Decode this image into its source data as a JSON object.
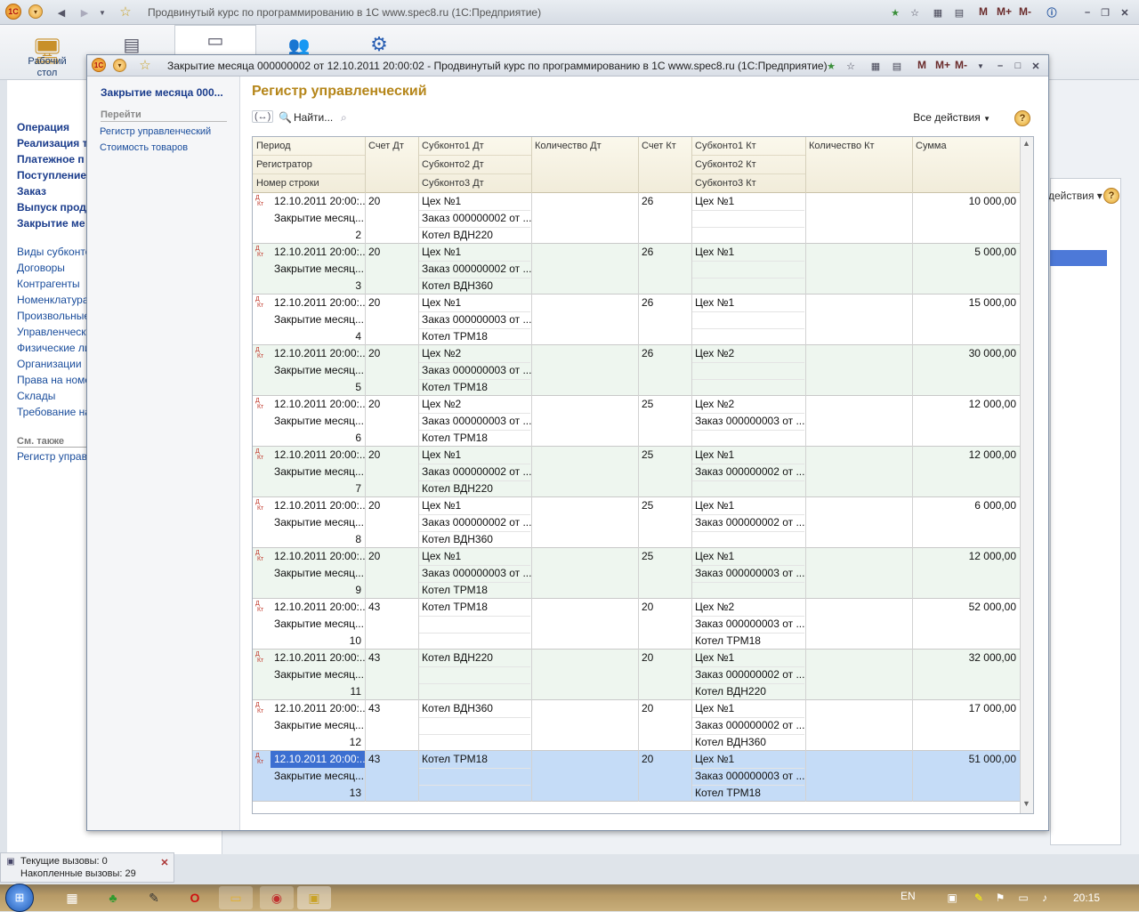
{
  "main_window": {
    "title": "Продвинутый курс по программированию в 1С www.spec8.ru  (1С:Предприятие)",
    "m_buttons": [
      "M",
      "M+",
      "M-"
    ]
  },
  "sections_panel": {
    "desktop_label_line1": "Рабочий",
    "desktop_label_line2": "стол"
  },
  "left_nav": {
    "bold_items": [
      "Операция",
      "Реализация т",
      "Платежное п",
      "Поступление",
      "Заказ",
      "Выпуск прод",
      "Закрытие ме"
    ],
    "items": [
      "Виды субконто",
      "Договоры",
      "Контрагенты",
      "Номенклатура",
      "Произвольные",
      "Управленчески",
      "Физические ли",
      "Организации",
      "Права на номен",
      "Склады",
      "Требование на"
    ],
    "see_also_label": "См. также",
    "see_also_items": [
      "Регистр управл"
    ]
  },
  "background_panel": {
    "actions_label": "действия ▾"
  },
  "dialog": {
    "title": "Закрытие месяца 000000002 от 12.10.2011 20:00:02 - Продвинутый курс по программированию в 1С www.spec8.ru  (1С:Предприятие)",
    "m_buttons": [
      "M",
      "M+",
      "M-"
    ],
    "sidebar": {
      "doc_link": "Закрытие месяца 000...",
      "goto_label": "Перейти",
      "links": [
        "Регистр управленческий",
        "Стоимость товаров"
      ]
    },
    "form_title": "Регистр управленческий",
    "command_bar": {
      "find_label": "Найти...",
      "all_actions_label": "Все действия",
      "help_label": "?"
    },
    "table": {
      "headers": {
        "period": "Период",
        "registrar": "Регистратор",
        "line_no": "Номер строки",
        "acc_dt": "Счет Дт",
        "sub1_dt": "Субконто1 Дт",
        "sub2_dt": "Субконто2 Дт",
        "sub3_dt": "Субконто3 Дт",
        "qty_dt": "Количество Дт",
        "acc_kt": "Счет Кт",
        "sub1_kt": "Субконто1 Кт",
        "sub2_kt": "Субконто2 Кт",
        "sub3_kt": "Субконто3 Кт",
        "qty_kt": "Количество Кт",
        "sum": "Сумма"
      },
      "rows": [
        {
          "period": "12.10.2011 20:00:...",
          "registrar": "Закрытие месяц...",
          "line": "2",
          "acc_dt": "20",
          "sub1_dt": "Цех №1",
          "sub2_dt": "Заказ 000000002 от ...",
          "sub3_dt": "Котел ВДН220",
          "acc_kt": "26",
          "sub1_kt": "Цех №1",
          "sub2_kt": "",
          "sub3_kt": "",
          "sum": "10 000,00"
        },
        {
          "period": "12.10.2011 20:00:...",
          "registrar": "Закрытие месяц...",
          "line": "3",
          "acc_dt": "20",
          "sub1_dt": "Цех №1",
          "sub2_dt": "Заказ 000000002 от ...",
          "sub3_dt": "Котел ВДН360",
          "acc_kt": "26",
          "sub1_kt": "Цех №1",
          "sub2_kt": "",
          "sub3_kt": "",
          "sum": "5 000,00"
        },
        {
          "period": "12.10.2011 20:00:...",
          "registrar": "Закрытие месяц...",
          "line": "4",
          "acc_dt": "20",
          "sub1_dt": "Цех №1",
          "sub2_dt": "Заказ 000000003 от ...",
          "sub3_dt": "Котел ТРМ18",
          "acc_kt": "26",
          "sub1_kt": "Цех №1",
          "sub2_kt": "",
          "sub3_kt": "",
          "sum": "15 000,00"
        },
        {
          "period": "12.10.2011 20:00:...",
          "registrar": "Закрытие месяц...",
          "line": "5",
          "acc_dt": "20",
          "sub1_dt": "Цех №2",
          "sub2_dt": "Заказ 000000003 от ...",
          "sub3_dt": "Котел ТРМ18",
          "acc_kt": "26",
          "sub1_kt": "Цех №2",
          "sub2_kt": "",
          "sub3_kt": "",
          "sum": "30 000,00"
        },
        {
          "period": "12.10.2011 20:00:...",
          "registrar": "Закрытие месяц...",
          "line": "6",
          "acc_dt": "20",
          "sub1_dt": "Цех №2",
          "sub2_dt": "Заказ 000000003 от ...",
          "sub3_dt": "Котел ТРМ18",
          "acc_kt": "25",
          "sub1_kt": "Цех №2",
          "sub2_kt": "Заказ 000000003 от ...",
          "sub3_kt": "",
          "sum": "12 000,00"
        },
        {
          "period": "12.10.2011 20:00:...",
          "registrar": "Закрытие месяц...",
          "line": "7",
          "acc_dt": "20",
          "sub1_dt": "Цех №1",
          "sub2_dt": "Заказ 000000002 от ...",
          "sub3_dt": "Котел ВДН220",
          "acc_kt": "25",
          "sub1_kt": "Цех №1",
          "sub2_kt": "Заказ 000000002 от ...",
          "sub3_kt": "",
          "sum": "12 000,00"
        },
        {
          "period": "12.10.2011 20:00:...",
          "registrar": "Закрытие месяц...",
          "line": "8",
          "acc_dt": "20",
          "sub1_dt": "Цех №1",
          "sub2_dt": "Заказ 000000002 от ...",
          "sub3_dt": "Котел ВДН360",
          "acc_kt": "25",
          "sub1_kt": "Цех №1",
          "sub2_kt": "Заказ 000000002 от ...",
          "sub3_kt": "",
          "sum": "6 000,00"
        },
        {
          "period": "12.10.2011 20:00:...",
          "registrar": "Закрытие месяц...",
          "line": "9",
          "acc_dt": "20",
          "sub1_dt": "Цех №1",
          "sub2_dt": "Заказ 000000003 от ...",
          "sub3_dt": "Котел ТРМ18",
          "acc_kt": "25",
          "sub1_kt": "Цех №1",
          "sub2_kt": "Заказ 000000003 от ...",
          "sub3_kt": "",
          "sum": "12 000,00"
        },
        {
          "period": "12.10.2011 20:00:...",
          "registrar": "Закрытие месяц...",
          "line": "10",
          "acc_dt": "43",
          "sub1_dt": "Котел ТРМ18",
          "sub2_dt": "",
          "sub3_dt": "",
          "acc_kt": "20",
          "sub1_kt": "Цех №2",
          "sub2_kt": "Заказ 000000003 от ...",
          "sub3_kt": "Котел ТРМ18",
          "sum": "52 000,00"
        },
        {
          "period": "12.10.2011 20:00:...",
          "registrar": "Закрытие месяц...",
          "line": "11",
          "acc_dt": "43",
          "sub1_dt": "Котел ВДН220",
          "sub2_dt": "",
          "sub3_dt": "",
          "acc_kt": "20",
          "sub1_kt": "Цех №1",
          "sub2_kt": "Заказ 000000002 от ...",
          "sub3_kt": "Котел ВДН220",
          "sum": "32 000,00"
        },
        {
          "period": "12.10.2011 20:00:...",
          "registrar": "Закрытие месяц...",
          "line": "12",
          "acc_dt": "43",
          "sub1_dt": "Котел ВДН360",
          "sub2_dt": "",
          "sub3_dt": "",
          "acc_kt": "20",
          "sub1_kt": "Цех №1",
          "sub2_kt": "Заказ 000000002 от ...",
          "sub3_kt": "Котел ВДН360",
          "sum": "17 000,00"
        },
        {
          "period": "12.10.2011 20:00:...",
          "registrar": "Закрытие месяц...",
          "line": "13",
          "acc_dt": "43",
          "sub1_dt": "Котел ТРМ18",
          "sub2_dt": "",
          "sub3_dt": "",
          "acc_kt": "20",
          "sub1_kt": "Цех №1",
          "sub2_kt": "Заказ 000000003 от ...",
          "sub3_kt": "Котел ТРМ18",
          "sum": "51 000,00"
        }
      ]
    }
  },
  "status_panel": {
    "current_calls": "Текущие вызовы: 0",
    "accumulated_calls": "Накопленные вызовы: 29"
  },
  "taskbar": {
    "language": "EN",
    "time": "20:15"
  },
  "colors": {
    "form_title": "#b5861a",
    "link_blue": "#1a4d9c",
    "selected_row": "#c5dcf7",
    "alt_row": "#eef6ef"
  }
}
